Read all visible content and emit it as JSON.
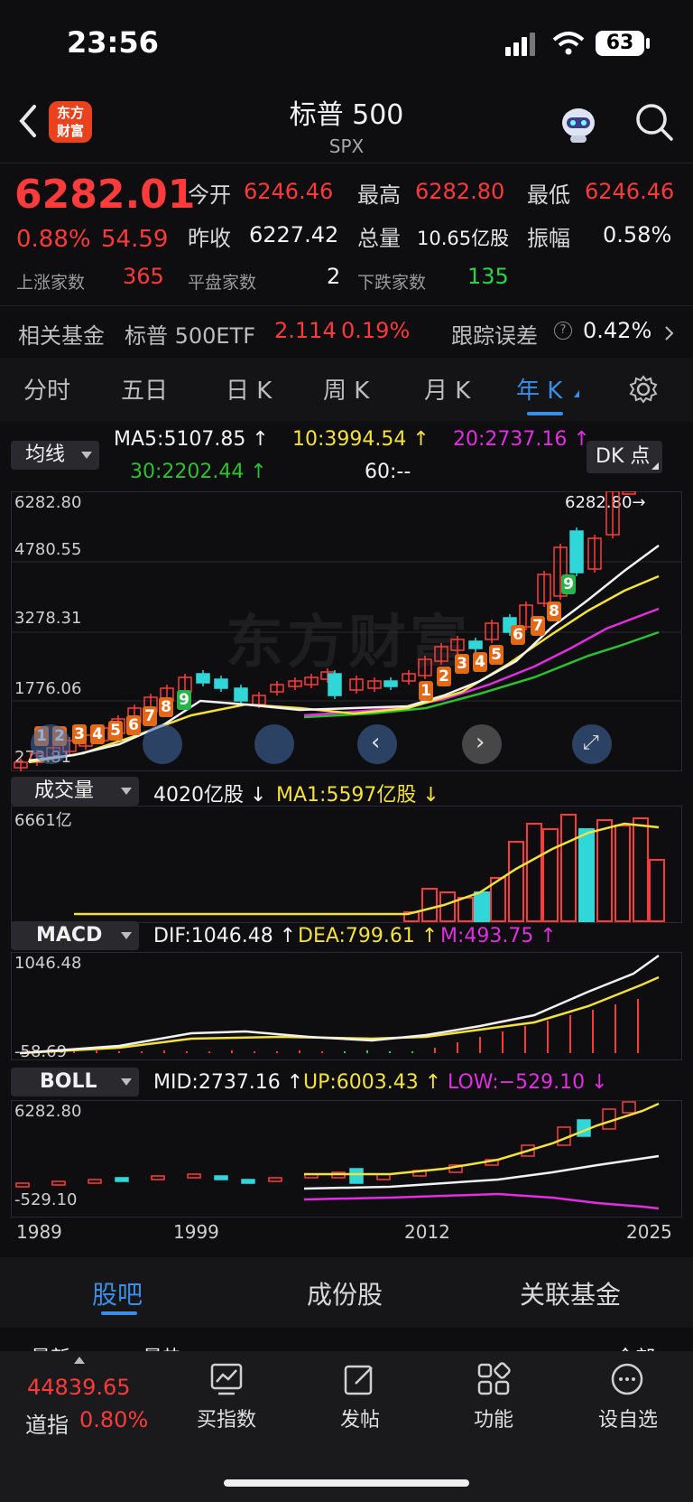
{
  "status_bar": {
    "time": "23:56",
    "battery": "63"
  },
  "header": {
    "title": "标普 500",
    "subtitle": "SPX",
    "logo_text": "东方\n财富"
  },
  "quote": {
    "price": "6282.01",
    "change_pct": "0.88%",
    "change_abs": "54.59",
    "open_label": "今开",
    "open": "6246.46",
    "high_label": "最高",
    "high": "6282.80",
    "low_label": "最低",
    "low": "6246.46",
    "prev_label": "昨收",
    "prev": "6227.42",
    "vol_label": "总量",
    "vol": "10.65亿股",
    "amp_label": "振幅",
    "amp": "0.58%",
    "up_label": "上涨家数",
    "up": "365",
    "flat_label": "平盘家数",
    "flat": "2",
    "down_label": "下跌家数",
    "down": "135"
  },
  "fund": {
    "label": "相关基金",
    "name": "标普 500ETF",
    "price": "2.114",
    "pct": "0.19%",
    "err_label": "跟踪误差",
    "err": "0.42%"
  },
  "tabs": [
    "分时",
    "五日",
    "日 K",
    "周 K",
    "月 K",
    "年 K"
  ],
  "active_tab": "年 K",
  "ma": {
    "label": "均线",
    "ma5": "MA5:5107.85 ↑",
    "ma10": "10:3994.54 ↑",
    "ma20": "20:2737.16 ↑",
    "ma30": "30:2202.44 ↑",
    "ma60": "60:--",
    "dk": "DK 点"
  },
  "price_axis": [
    "6282.80",
    "4780.55",
    "3278.31",
    "1776.06",
    "273.81"
  ],
  "price_marker": "6282.80→",
  "volume": {
    "label": "成交量",
    "val": "4020亿股 ↓",
    "ma1": "MA1:5597亿股 ↓",
    "axis": "6661亿"
  },
  "macd": {
    "label": "MACD",
    "dif": "DIF:1046.48 ↑",
    "dea": "DEA:799.61 ↑",
    "m": "M:493.75 ↑",
    "axis_top": "1046.48",
    "axis_bot": "-58.69"
  },
  "boll": {
    "label": "BOLL",
    "mid": "MID:2737.16 ↑",
    "up": "UP:6003.43 ↑",
    "low": "LOW:−529.10 ↓",
    "axis_top": "6282.80",
    "axis_bot": "-529.10"
  },
  "x_axis": [
    "1989",
    "1999",
    "2012",
    "2025"
  ],
  "seq_numbers": [
    "1",
    "2",
    "3",
    "4",
    "5",
    "6",
    "7",
    "8",
    "9",
    "1",
    "2",
    "3",
    "4",
    "5",
    "6",
    "7",
    "8",
    "9"
  ],
  "bottom_tabs": [
    "股吧",
    "成份股",
    "关联基金"
  ],
  "sub_tabs": [
    "最新",
    "最热",
    "全部"
  ],
  "index_mini": {
    "value": "44839.65",
    "name": "道指",
    "pct": "0.80%"
  },
  "nav": [
    "买指数",
    "发帖",
    "功能",
    "设自选"
  ],
  "watermark": "东方财富",
  "colors": {
    "up": "#ff3b3b",
    "down": "#2bd24b",
    "cyan": "#2fd7d9",
    "accent": "#3a8ee6"
  }
}
